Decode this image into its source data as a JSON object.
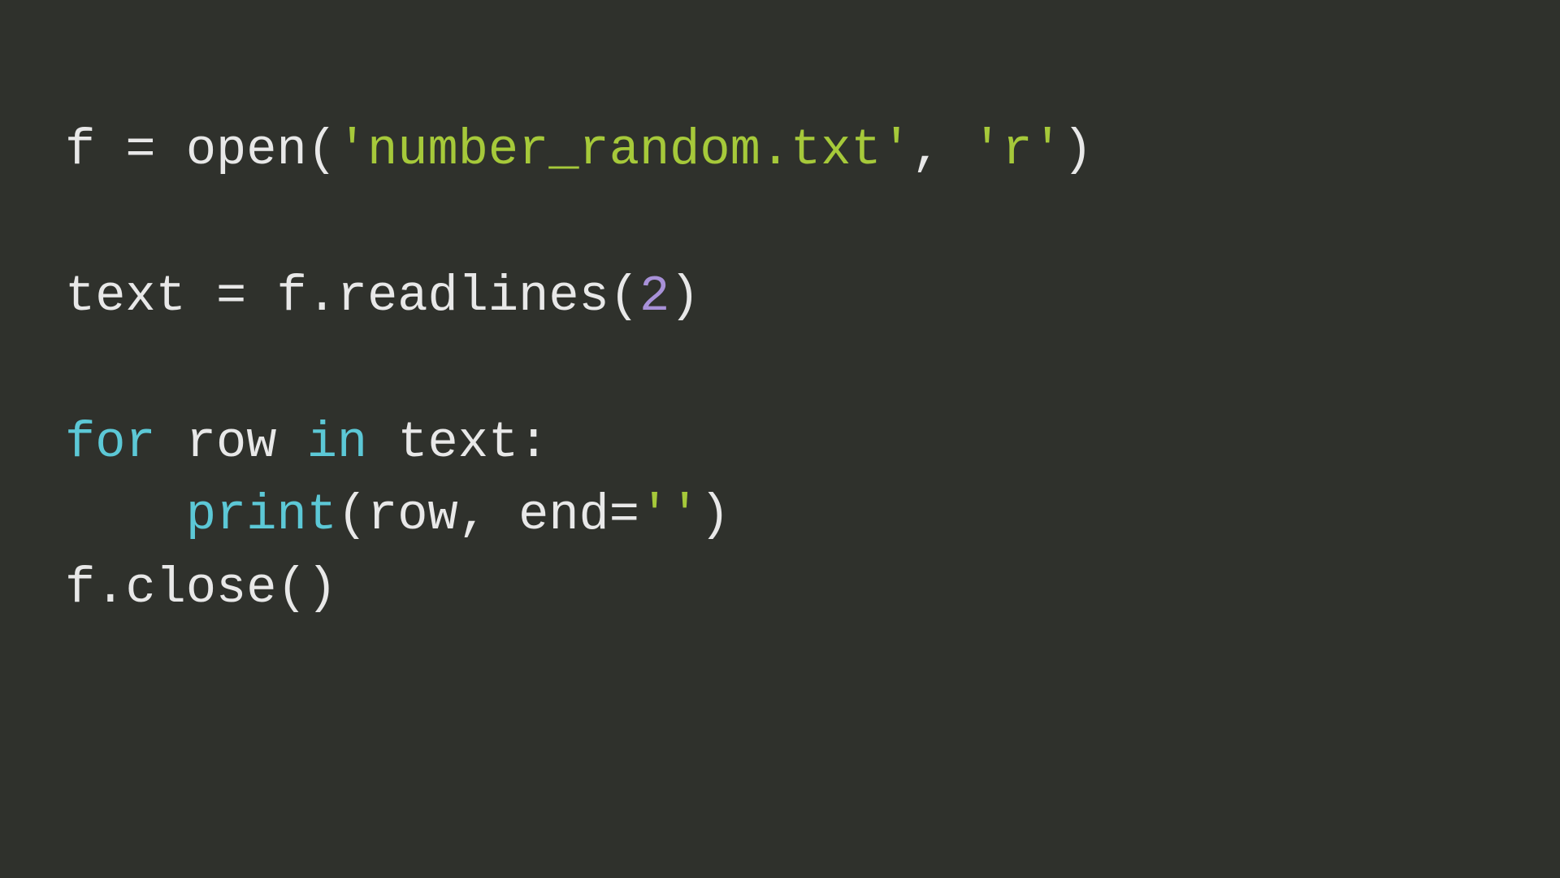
{
  "code": {
    "line1": {
      "var_f": "f",
      "eq": " = ",
      "open": "open",
      "lparen": "(",
      "str_filename": "'number_random.txt'",
      "comma": ", ",
      "str_mode": "'r'",
      "rparen": ")"
    },
    "line2_blank": "",
    "line3": {
      "var_text": "text",
      "eq": " = ",
      "var_f": "f",
      "dot": ".",
      "method": "readlines",
      "lparen": "(",
      "num": "2",
      "rparen": ")"
    },
    "line4_blank": "",
    "line5": {
      "kw_for": "for",
      "sp1": " ",
      "var_row": "row",
      "sp2": " ",
      "kw_in": "in",
      "sp3": " ",
      "var_text": "text",
      "colon": ":"
    },
    "line6": {
      "indent": "    ",
      "print": "print",
      "lparen": "(",
      "var_row": "row",
      "comma": ", ",
      "kw_end": "end",
      "eq": "=",
      "str_empty": "''",
      "rparen": ")"
    },
    "line7": {
      "var_f": "f",
      "dot": ".",
      "method": "close",
      "lparen": "(",
      "rparen": ")"
    }
  }
}
